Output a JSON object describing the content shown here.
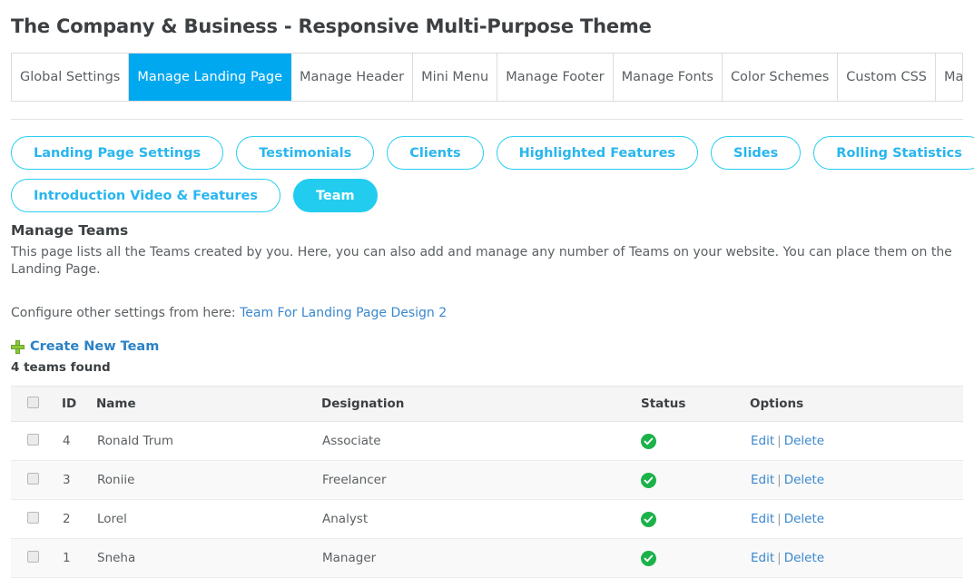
{
  "page_title": "The Company & Business - Responsive Multi-Purpose Theme",
  "colors": {
    "active_tab": "#00a8f0",
    "pill_border": "#29cdf4",
    "pill_text": "#29b6ee",
    "pill_active_bg": "#22ccee",
    "link": "#3a87cd",
    "status_ok": "#1bb24a",
    "plus_icon": "#8cc63e"
  },
  "tabs": [
    {
      "label": "Global Settings",
      "active": false
    },
    {
      "label": "Manage Landing Page",
      "active": true
    },
    {
      "label": "Manage Header",
      "active": false
    },
    {
      "label": "Mini Menu",
      "active": false
    },
    {
      "label": "Manage Footer",
      "active": false
    },
    {
      "label": "Manage Fonts",
      "active": false
    },
    {
      "label": "Color Schemes",
      "active": false
    },
    {
      "label": "Custom CSS",
      "active": false
    },
    {
      "label": "Manage Banners",
      "active": false
    }
  ],
  "pills": [
    [
      {
        "label": "Landing Page Settings",
        "active": false
      },
      {
        "label": "Testimonials",
        "active": false
      },
      {
        "label": "Clients",
        "active": false
      },
      {
        "label": "Highlighted Features",
        "active": false
      },
      {
        "label": "Slides",
        "active": false
      },
      {
        "label": "Rolling Statistics",
        "active": false
      }
    ],
    [
      {
        "label": "Introduction Video & Features",
        "active": false
      },
      {
        "label": "Team",
        "active": true
      }
    ]
  ],
  "section": {
    "title": "Manage Teams",
    "description": "This page lists all the Teams created by you. Here, you can also add and manage any number of Teams on your website. You can place them on the Landing Page."
  },
  "configure": {
    "prefix": "Configure other settings from here:",
    "link_label": "Team For Landing Page Design 2"
  },
  "create_new": {
    "icon": "plus-icon",
    "label": "Create New Team"
  },
  "results_count": "4 teams found",
  "table": {
    "columns": [
      "",
      "ID",
      "Name",
      "Designation",
      "Status",
      "Options"
    ],
    "rows": [
      {
        "id": "4",
        "name": "Ronald Trum",
        "designation": "Associate",
        "status": "active",
        "edit": "Edit",
        "sep": "|",
        "delete": "Delete"
      },
      {
        "id": "3",
        "name": "Roniie",
        "designation": "Freelancer",
        "status": "active",
        "edit": "Edit",
        "sep": "|",
        "delete": "Delete"
      },
      {
        "id": "2",
        "name": "Lorel",
        "designation": "Analyst",
        "status": "active",
        "edit": "Edit",
        "sep": "|",
        "delete": "Delete"
      },
      {
        "id": "1",
        "name": "Sneha",
        "designation": "Manager",
        "status": "active",
        "edit": "Edit",
        "sep": "|",
        "delete": "Delete"
      }
    ]
  }
}
